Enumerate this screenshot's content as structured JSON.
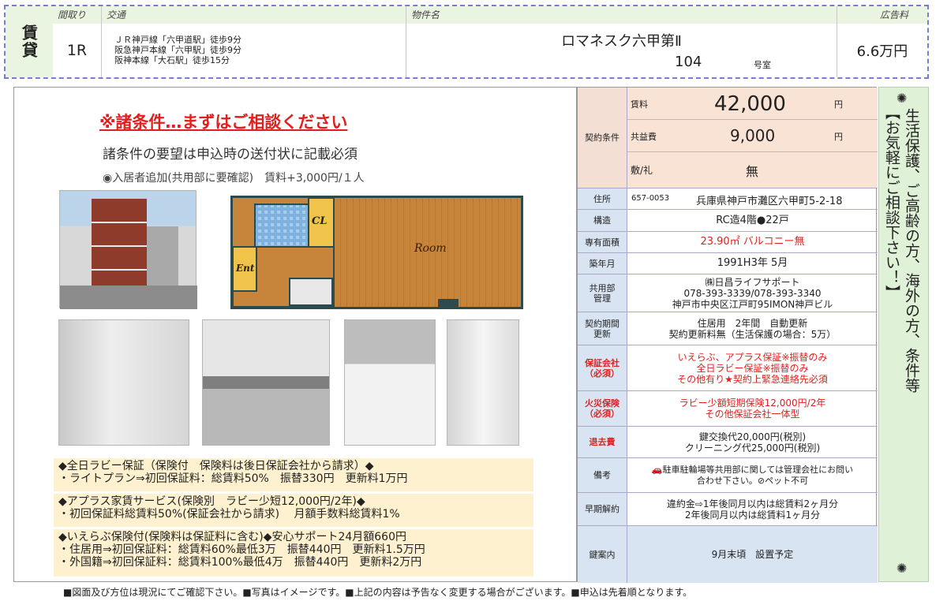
{
  "header": {
    "type_label": "賃貸",
    "layout_head": "間取り",
    "layout_value": "1R",
    "transport_head": "交通",
    "transport_lines": [
      "ＪＲ神戸線「六甲道駅」徒歩9分",
      "阪急神戸本線「六甲駅」徒歩9分",
      "阪神本線「大石駅」徒歩15分"
    ],
    "property_head": "物件名",
    "property_name": "ロマネスク六甲第Ⅱ",
    "room_number": "104",
    "room_suffix": "号室",
    "fee_head": "広告料",
    "fee_value": "6.6万円"
  },
  "left": {
    "headline": "※諸条件…まずはご相談ください",
    "subhead": "諸条件の要望は申込時の送付状に記載必須",
    "extra": "◉入居者追加(共用部に要確認)　賃料+3,000円/１人",
    "floorplan": {
      "room": "Room",
      "cl": "CL",
      "ent": "Ent"
    },
    "notes": [
      {
        "title": "◆全日ラビー保証（保険付　保険料は後日保証会社から請求）◆",
        "lines": [
          "・ライトプラン⇒初回保証料：総賃料50%　振替330円　更新料1万円"
        ]
      },
      {
        "title": "◆アプラス家賃サービス(保険別　ラビー少短12,000円/2年)◆",
        "lines": [
          "・初回保証料総賃料50%(保証会社から請求)　 月額手数料総賃料1%"
        ]
      },
      {
        "title": "◆いえらぶ保険付(保険料は保証料に含む)◆安心サポート24月額660円",
        "lines": [
          "・住居用⇒初回保証料：総賃料60%最低3万　振替440円　更新料1.5万円",
          "・外国籍⇒初回保証料：総賃料100%最低4万　振替440円　更新料2万円"
        ]
      }
    ]
  },
  "table": {
    "contract_label": "契約条件",
    "rent_label": "賃料",
    "rent_value": "42,000",
    "rent_unit": "円",
    "common_label": "共益費",
    "common_value": "9,000",
    "common_unit": "円",
    "deposit_label": "敷/礼",
    "deposit_value": "無",
    "address_label": "住所",
    "zip": "657-0053",
    "address": "兵庫県神戸市灘区六甲町5-2-18",
    "structure_label": "構造",
    "structure": "RC造4階●22戸",
    "area_label": "専有面積",
    "area": "23.90㎡ バルコニー無",
    "built_label": "築年月",
    "built": "1991H3年 5月",
    "mgmt_label": "共用部\n管理",
    "mgmt_lines": [
      "㈱日昌ライフサポート",
      "078-393-3339/078-393-3340",
      "神戸市中央区江戸町95IMON神戸ビル"
    ],
    "term_label": "契約期間\n更新",
    "term_lines": [
      "住居用　2年間　自動更新",
      "契約更新料無（生活保護の場合：5万）"
    ],
    "guarantee_label": "保証会社\n（必須）",
    "guarantee_lines": [
      "いえらぶ、アプラス保証※振替のみ",
      "全日ラビー保証※振替のみ",
      "その他有り★契約上緊急連絡先必須"
    ],
    "fire_label": "火災保険\n（必須）",
    "fire_lines": [
      "ラビー少額短期保険12,000円/2年",
      "その他保証会社一体型"
    ],
    "leave_label": "退去費",
    "leave_lines": [
      "鍵交換代20,000円(税別)",
      "クリーニング代25,000円(税別)"
    ],
    "remarks_label": "備考",
    "remarks_lines": [
      "🚗駐車駐輪場等共用部に関しては管理会社にお問い",
      "合わせ下さい。⊘ペット不可"
    ],
    "early_label": "早期解約",
    "early_lines": [
      "違約金⇨1年後同月以内は総賃料2ヶ月分",
      "2年後同月以内は総賃料1ヶ月分"
    ],
    "key_label": "鍵案内",
    "key_value": "9月末頃　設置予定"
  },
  "side": {
    "top_mark": "✺",
    "line1": "生活保護、ご高齢の方、海外の方、条件等",
    "line2": "【お気軽にご相談下さい！】",
    "bottom_mark": "✺"
  },
  "footer": "■図面及び方位は現況にてご確認下さい。■写真はイメージです。■上記の内容は予告なく変更する場合がございます。■申込は先着順となります。",
  "colors": {
    "accent_red": "#e02020",
    "label_blue": "#d9e4f2",
    "header_green": "#e9f4e1",
    "note_cream": "#fdf1cf",
    "floor_wood": "#c7843b"
  }
}
